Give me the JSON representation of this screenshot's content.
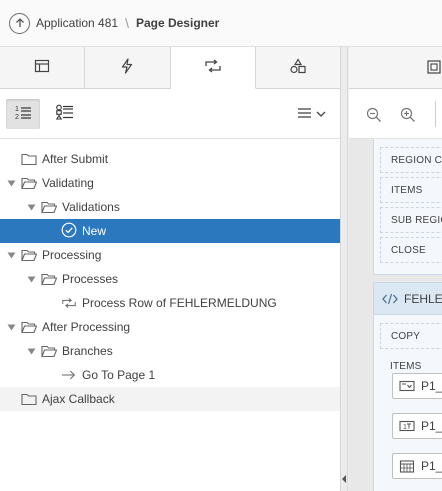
{
  "header": {
    "app_label": "Application 481",
    "separator": "\\",
    "page_title": "Page Designer"
  },
  "left_tabs": [
    {
      "icon": "layout-icon",
      "active": false
    },
    {
      "icon": "lightning-icon",
      "active": false
    },
    {
      "icon": "processing-icon",
      "active": true
    },
    {
      "icon": "shared-components-icon",
      "active": false
    }
  ],
  "tree": [
    {
      "label": "After Submit",
      "depth": 0,
      "expandable": false,
      "icon": "folder-icon"
    },
    {
      "label": "Validating",
      "depth": 0,
      "expandable": true,
      "icon": "folder-open-icon"
    },
    {
      "label": "Validations",
      "depth": 1,
      "expandable": true,
      "icon": "folder-open-icon"
    },
    {
      "label": "New",
      "depth": 2,
      "expandable": false,
      "icon": "check-circle-icon",
      "selected": true
    },
    {
      "label": "Processing",
      "depth": 0,
      "expandable": true,
      "icon": "folder-open-icon"
    },
    {
      "label": "Processes",
      "depth": 1,
      "expandable": true,
      "icon": "folder-open-icon"
    },
    {
      "label": "Process Row of FEHLERMELDUNG",
      "depth": 2,
      "expandable": false,
      "icon": "process-icon"
    },
    {
      "label": "After Processing",
      "depth": 0,
      "expandable": true,
      "icon": "folder-open-icon"
    },
    {
      "label": "Branches",
      "depth": 1,
      "expandable": true,
      "icon": "folder-open-icon"
    },
    {
      "label": "Go To Page 1",
      "depth": 2,
      "expandable": false,
      "icon": "arrow-right-icon"
    },
    {
      "label": "Ajax Callback",
      "depth": 0,
      "expandable": false,
      "icon": "folder-icon"
    }
  ],
  "layout": {
    "region_slots_top": [
      "REGION CONTENT",
      "ITEMS",
      "SUB REGIONS",
      "CLOSE"
    ],
    "region_title": "FEHLERMELDUNG",
    "region_slots_bottom": [
      "COPY",
      "ITEMS"
    ],
    "items": [
      {
        "label": "P1_",
        "icon": "select-list-icon"
      },
      {
        "label": "P1_",
        "icon": "number-field-icon"
      },
      {
        "label": "P1_",
        "icon": "date-picker-icon"
      }
    ]
  },
  "colors": {
    "selected_row": "#2b78bf",
    "region_header": "#dbe7f3"
  }
}
